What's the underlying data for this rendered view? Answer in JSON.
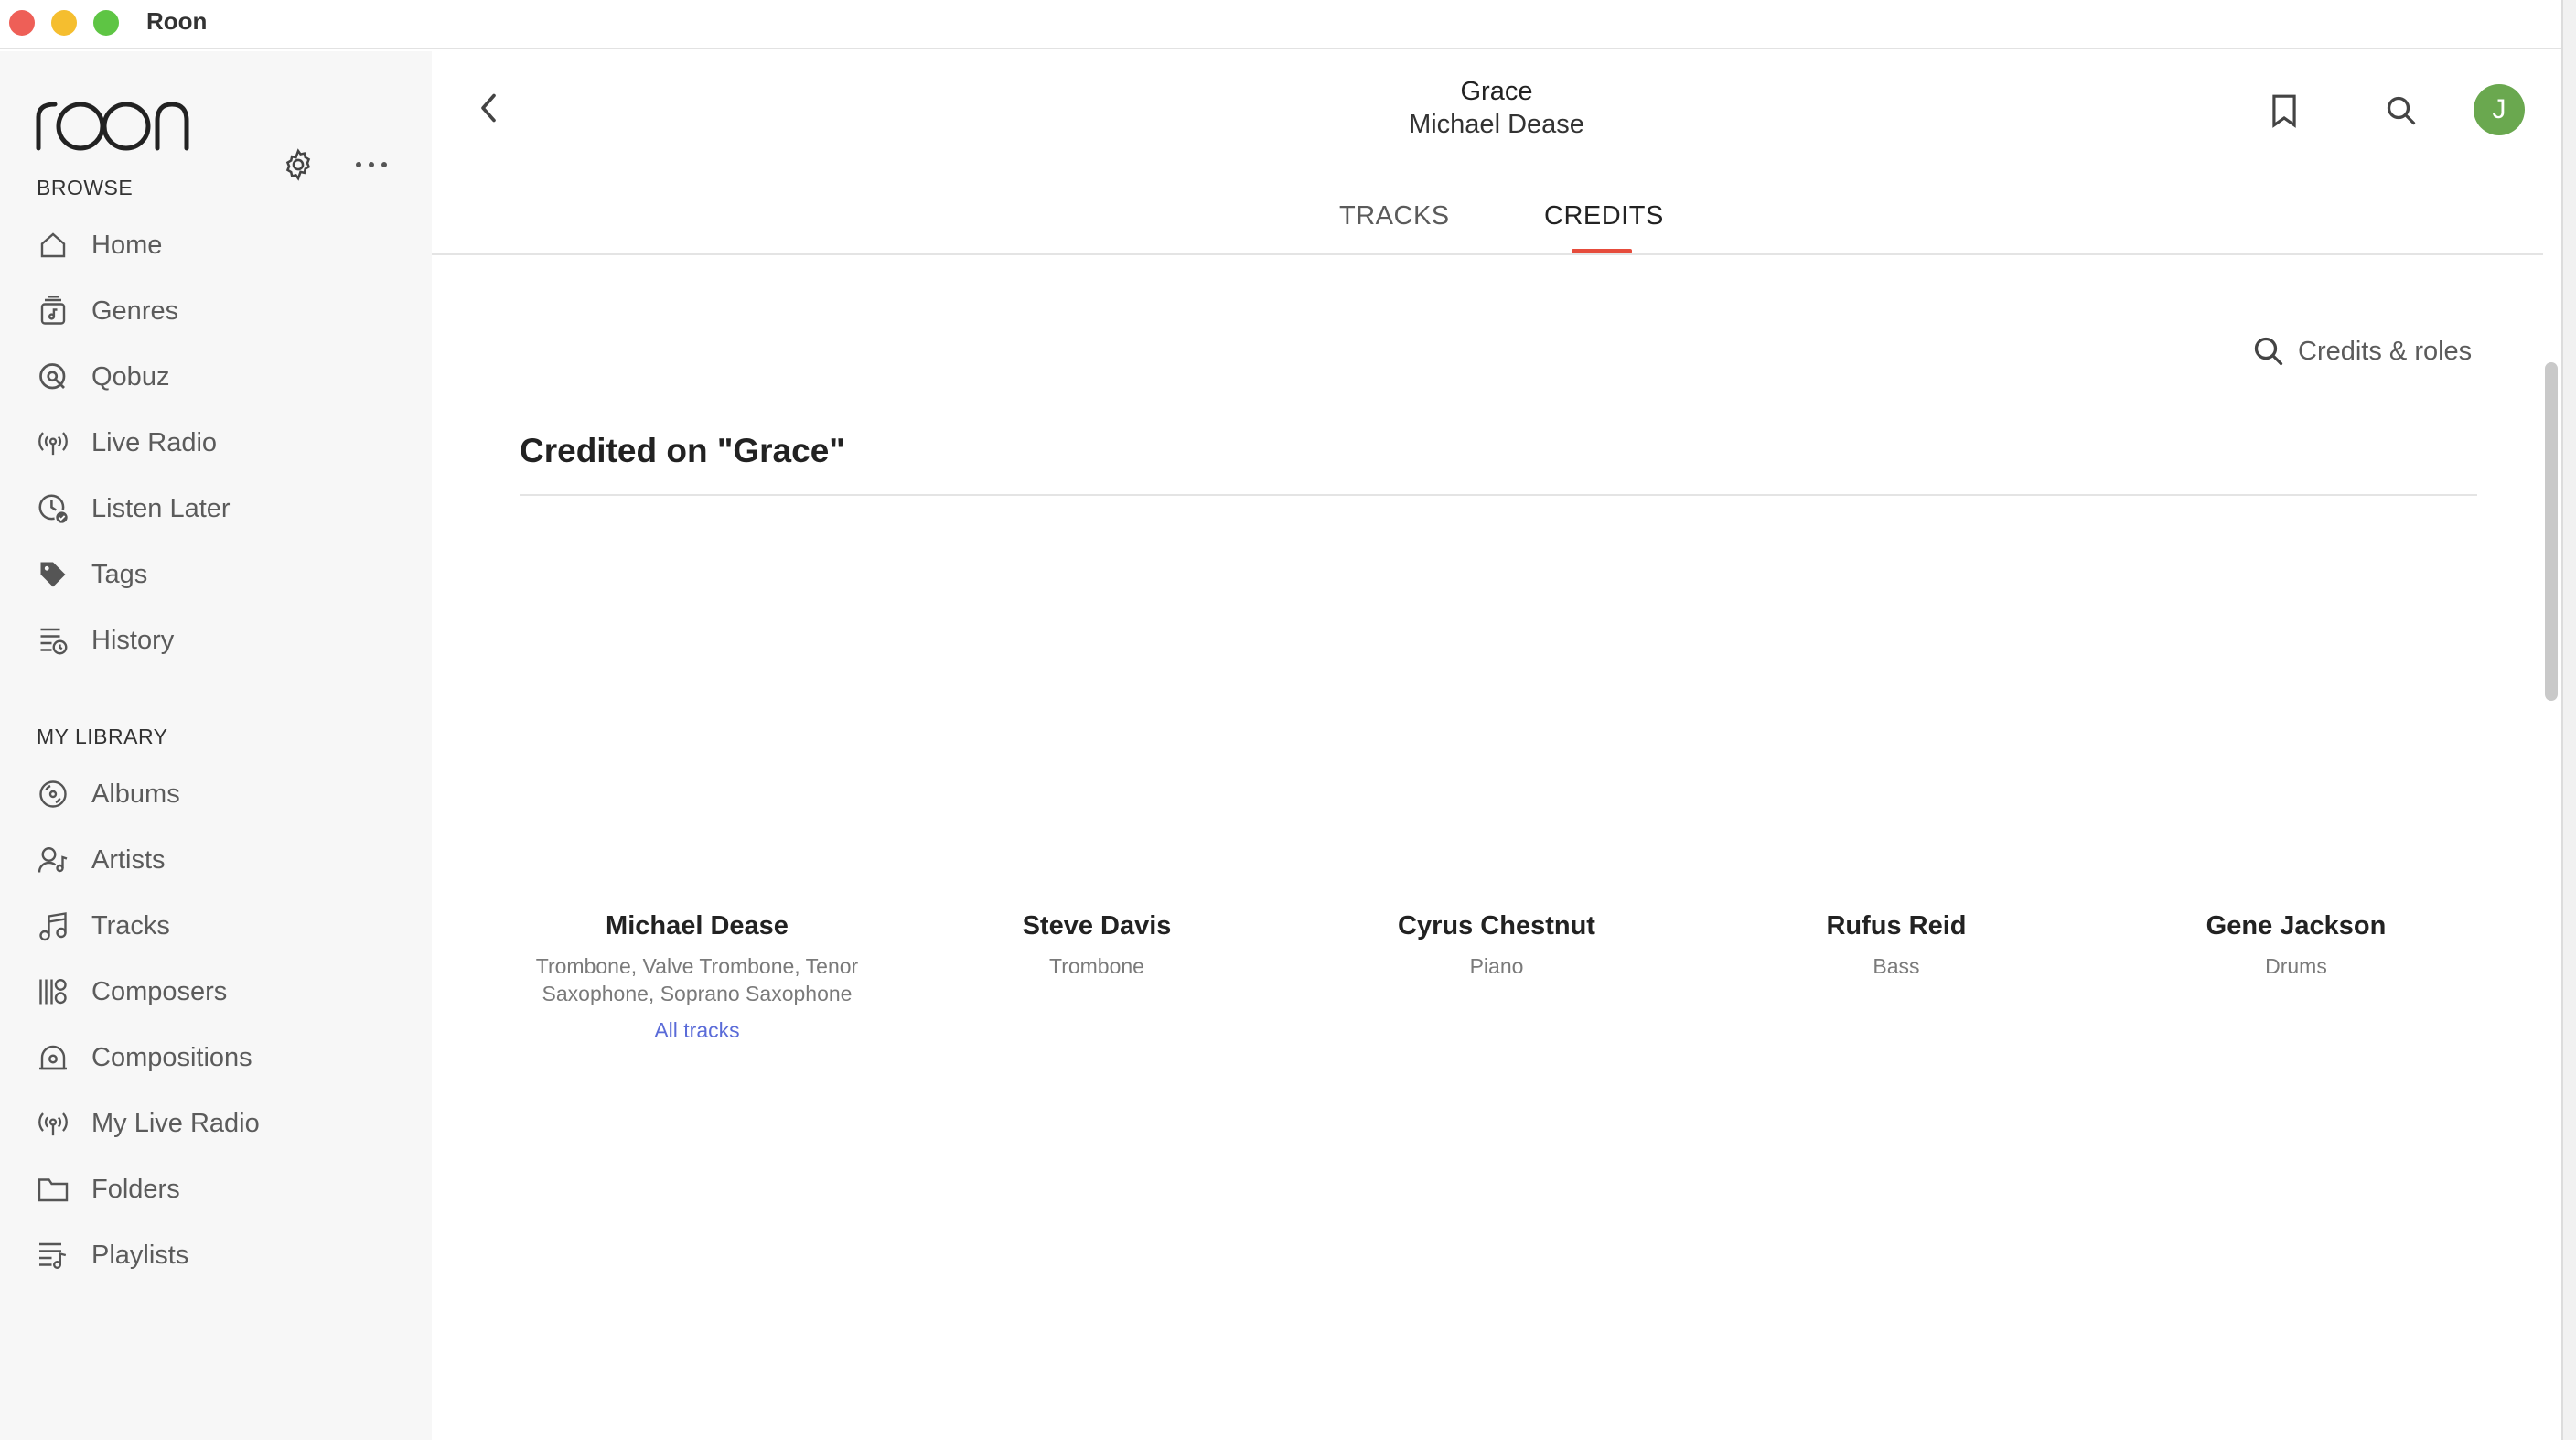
{
  "window": {
    "title": "Roon"
  },
  "sidebar": {
    "logo_text": "roon",
    "browse_label": "BROWSE",
    "browse_items": [
      {
        "label": "Home",
        "icon": "home-icon"
      },
      {
        "label": "Genres",
        "icon": "genres-icon"
      },
      {
        "label": "Qobuz",
        "icon": "qobuz-icon"
      },
      {
        "label": "Live Radio",
        "icon": "radio-icon"
      },
      {
        "label": "Listen Later",
        "icon": "listen-later-icon"
      },
      {
        "label": "Tags",
        "icon": "tag-icon"
      },
      {
        "label": "History",
        "icon": "history-icon"
      }
    ],
    "library_label": "MY LIBRARY",
    "library_items": [
      {
        "label": "Albums",
        "icon": "album-icon"
      },
      {
        "label": "Artists",
        "icon": "artist-icon"
      },
      {
        "label": "Tracks",
        "icon": "music-note-icon"
      },
      {
        "label": "Composers",
        "icon": "composer-icon"
      },
      {
        "label": "Compositions",
        "icon": "composition-icon"
      },
      {
        "label": "My Live Radio",
        "icon": "radio-icon"
      },
      {
        "label": "Folders",
        "icon": "folder-icon"
      },
      {
        "label": "Playlists",
        "icon": "playlist-icon"
      }
    ]
  },
  "header": {
    "title": "Grace",
    "subtitle": "Michael Dease",
    "avatar_initial": "J"
  },
  "tabs": [
    {
      "label": "TRACKS",
      "active": false
    },
    {
      "label": "CREDITS",
      "active": true
    }
  ],
  "credits_search": {
    "label": "Credits & roles"
  },
  "section": {
    "heading": "Credited on \"Grace\""
  },
  "credits": [
    {
      "name": "Michael Dease",
      "role": "Trombone, Valve Trombone, Tenor Saxophone, Soprano Saxophone",
      "link": "All tracks"
    },
    {
      "name": "Steve Davis",
      "role": "Trombone"
    },
    {
      "name": "Cyrus Chestnut",
      "role": "Piano"
    },
    {
      "name": "Rufus Reid",
      "role": "Bass"
    },
    {
      "name": "Gene Jackson",
      "role": "Drums"
    }
  ],
  "colors": {
    "accent": "#e64c3c",
    "link": "#5a6bd8",
    "avatar": "#6aa84f"
  }
}
